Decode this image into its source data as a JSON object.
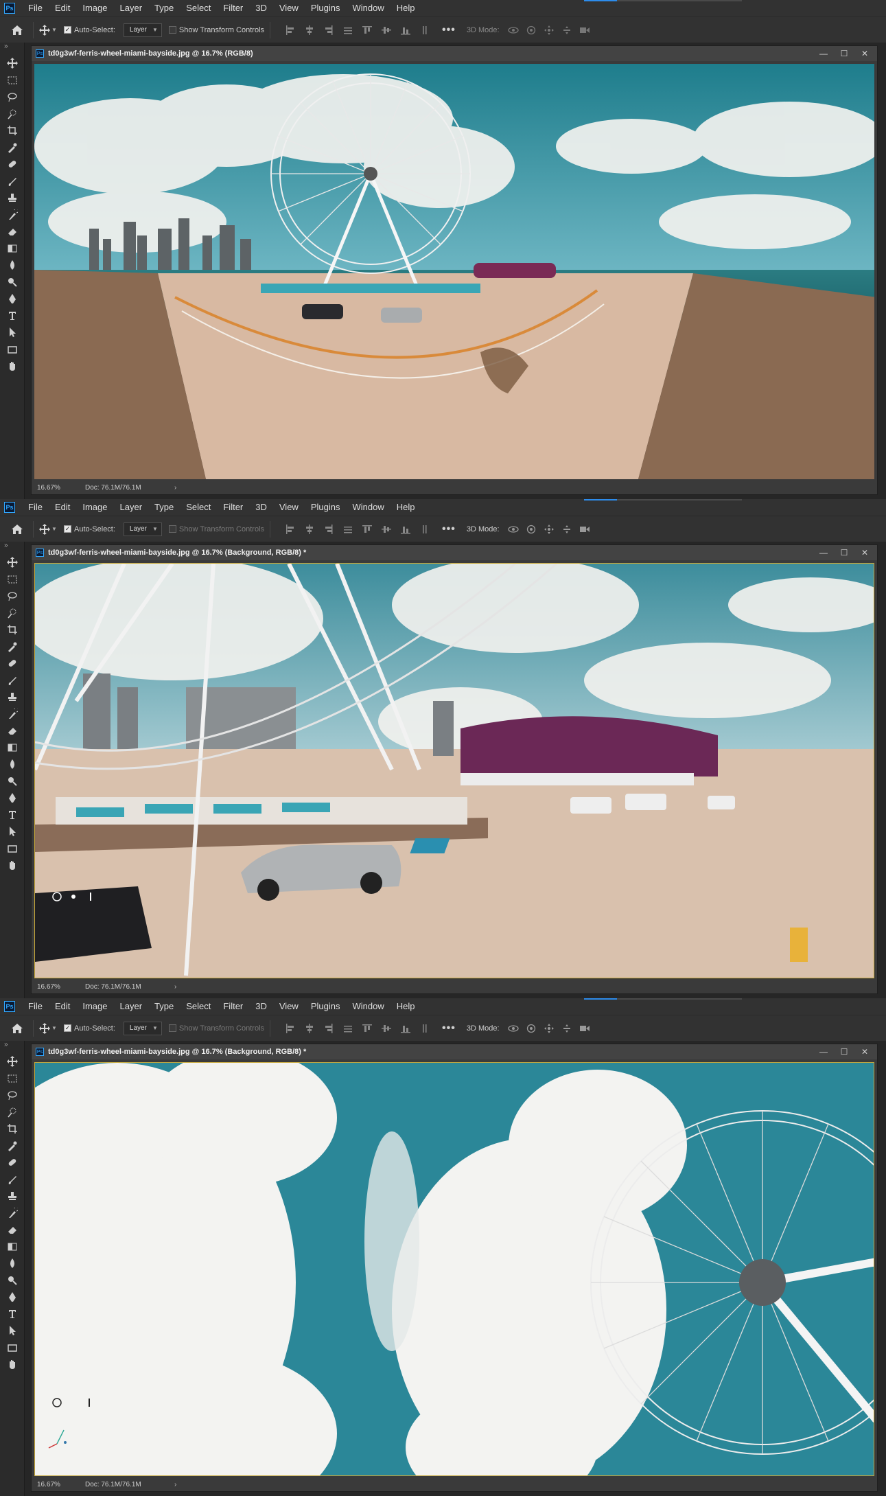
{
  "menu": [
    "File",
    "Edit",
    "Image",
    "Layer",
    "Type",
    "Select",
    "Filter",
    "3D",
    "View",
    "Plugins",
    "Window",
    "Help"
  ],
  "app_logo": "Ps",
  "options": {
    "auto_select_label": "Auto-Select:",
    "layer_select_value": "Layer",
    "show_transform_label": "Show Transform Controls",
    "more_label": "•••",
    "mode_label": "3D Mode:"
  },
  "windows": [
    {
      "title": "td0g3wf-ferris-wheel-miami-bayside.jpg @ 16.7% (RGB/8)",
      "zoom": "16.67%",
      "doc_size": "Doc: 76.1M/76.1M",
      "view": "equirectangular-panorama",
      "show_transform_enabled": true,
      "mode_enabled": false
    },
    {
      "title": "td0g3wf-ferris-wheel-miami-bayside.jpg @ 16.7% (Background, RGB/8) *",
      "zoom": "16.67%",
      "doc_size": "Doc: 76.1M/76.1M",
      "view": "spherical-view-pier",
      "show_transform_enabled": false,
      "mode_enabled": true
    },
    {
      "title": "td0g3wf-ferris-wheel-miami-bayside.jpg @ 16.7% (Background, RGB/8) *",
      "zoom": "16.67%",
      "doc_size": "Doc: 76.1M/76.1M",
      "view": "spherical-view-sky",
      "show_transform_enabled": false,
      "mode_enabled": true
    }
  ],
  "tools": [
    "move-tool-icon",
    "marquee-tool-icon",
    "lasso-tool-icon",
    "quick-select-tool-icon",
    "crop-tool-icon",
    "eyedropper-tool-icon",
    "healing-brush-icon",
    "brush-tool-icon",
    "clone-stamp-icon",
    "history-brush-icon",
    "eraser-tool-icon",
    "gradient-tool-icon",
    "blur-tool-icon",
    "dodge-tool-icon",
    "pen-tool-icon",
    "type-tool-icon",
    "path-select-icon",
    "rectangle-tool-icon",
    "hand-tool-icon"
  ],
  "colors": {
    "accent": "#31a8ff",
    "selection_border": "#c7a83a",
    "chrome": "#323232",
    "panel": "#262626"
  }
}
